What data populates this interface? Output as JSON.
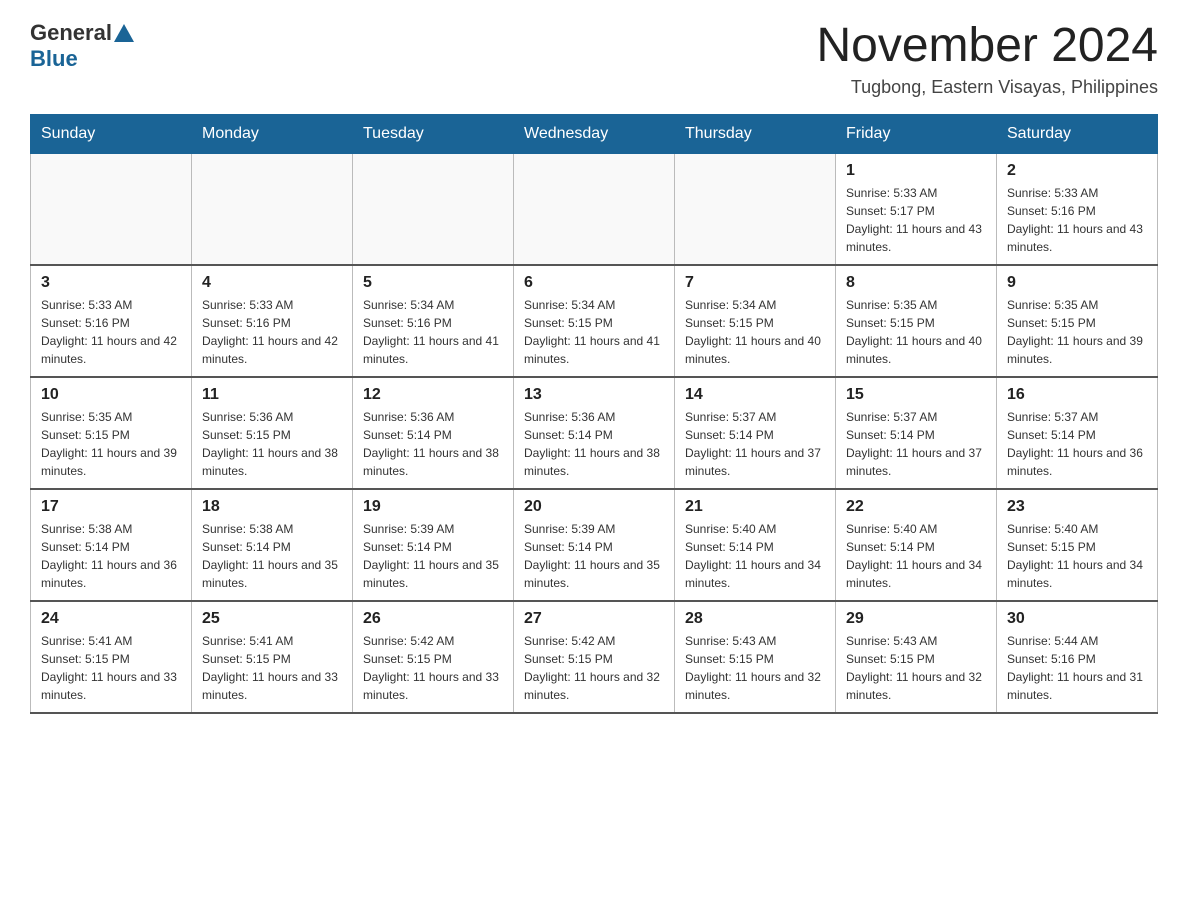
{
  "header": {
    "logo": {
      "general": "General",
      "blue": "Blue"
    },
    "title": "November 2024",
    "subtitle": "Tugbong, Eastern Visayas, Philippines"
  },
  "calendar": {
    "days_of_week": [
      "Sunday",
      "Monday",
      "Tuesday",
      "Wednesday",
      "Thursday",
      "Friday",
      "Saturday"
    ],
    "weeks": [
      [
        {
          "day": "",
          "info": ""
        },
        {
          "day": "",
          "info": ""
        },
        {
          "day": "",
          "info": ""
        },
        {
          "day": "",
          "info": ""
        },
        {
          "day": "",
          "info": ""
        },
        {
          "day": "1",
          "info": "Sunrise: 5:33 AM\nSunset: 5:17 PM\nDaylight: 11 hours and 43 minutes."
        },
        {
          "day": "2",
          "info": "Sunrise: 5:33 AM\nSunset: 5:16 PM\nDaylight: 11 hours and 43 minutes."
        }
      ],
      [
        {
          "day": "3",
          "info": "Sunrise: 5:33 AM\nSunset: 5:16 PM\nDaylight: 11 hours and 42 minutes."
        },
        {
          "day": "4",
          "info": "Sunrise: 5:33 AM\nSunset: 5:16 PM\nDaylight: 11 hours and 42 minutes."
        },
        {
          "day": "5",
          "info": "Sunrise: 5:34 AM\nSunset: 5:16 PM\nDaylight: 11 hours and 41 minutes."
        },
        {
          "day": "6",
          "info": "Sunrise: 5:34 AM\nSunset: 5:15 PM\nDaylight: 11 hours and 41 minutes."
        },
        {
          "day": "7",
          "info": "Sunrise: 5:34 AM\nSunset: 5:15 PM\nDaylight: 11 hours and 40 minutes."
        },
        {
          "day": "8",
          "info": "Sunrise: 5:35 AM\nSunset: 5:15 PM\nDaylight: 11 hours and 40 minutes."
        },
        {
          "day": "9",
          "info": "Sunrise: 5:35 AM\nSunset: 5:15 PM\nDaylight: 11 hours and 39 minutes."
        }
      ],
      [
        {
          "day": "10",
          "info": "Sunrise: 5:35 AM\nSunset: 5:15 PM\nDaylight: 11 hours and 39 minutes."
        },
        {
          "day": "11",
          "info": "Sunrise: 5:36 AM\nSunset: 5:15 PM\nDaylight: 11 hours and 38 minutes."
        },
        {
          "day": "12",
          "info": "Sunrise: 5:36 AM\nSunset: 5:14 PM\nDaylight: 11 hours and 38 minutes."
        },
        {
          "day": "13",
          "info": "Sunrise: 5:36 AM\nSunset: 5:14 PM\nDaylight: 11 hours and 38 minutes."
        },
        {
          "day": "14",
          "info": "Sunrise: 5:37 AM\nSunset: 5:14 PM\nDaylight: 11 hours and 37 minutes."
        },
        {
          "day": "15",
          "info": "Sunrise: 5:37 AM\nSunset: 5:14 PM\nDaylight: 11 hours and 37 minutes."
        },
        {
          "day": "16",
          "info": "Sunrise: 5:37 AM\nSunset: 5:14 PM\nDaylight: 11 hours and 36 minutes."
        }
      ],
      [
        {
          "day": "17",
          "info": "Sunrise: 5:38 AM\nSunset: 5:14 PM\nDaylight: 11 hours and 36 minutes."
        },
        {
          "day": "18",
          "info": "Sunrise: 5:38 AM\nSunset: 5:14 PM\nDaylight: 11 hours and 35 minutes."
        },
        {
          "day": "19",
          "info": "Sunrise: 5:39 AM\nSunset: 5:14 PM\nDaylight: 11 hours and 35 minutes."
        },
        {
          "day": "20",
          "info": "Sunrise: 5:39 AM\nSunset: 5:14 PM\nDaylight: 11 hours and 35 minutes."
        },
        {
          "day": "21",
          "info": "Sunrise: 5:40 AM\nSunset: 5:14 PM\nDaylight: 11 hours and 34 minutes."
        },
        {
          "day": "22",
          "info": "Sunrise: 5:40 AM\nSunset: 5:14 PM\nDaylight: 11 hours and 34 minutes."
        },
        {
          "day": "23",
          "info": "Sunrise: 5:40 AM\nSunset: 5:15 PM\nDaylight: 11 hours and 34 minutes."
        }
      ],
      [
        {
          "day": "24",
          "info": "Sunrise: 5:41 AM\nSunset: 5:15 PM\nDaylight: 11 hours and 33 minutes."
        },
        {
          "day": "25",
          "info": "Sunrise: 5:41 AM\nSunset: 5:15 PM\nDaylight: 11 hours and 33 minutes."
        },
        {
          "day": "26",
          "info": "Sunrise: 5:42 AM\nSunset: 5:15 PM\nDaylight: 11 hours and 33 minutes."
        },
        {
          "day": "27",
          "info": "Sunrise: 5:42 AM\nSunset: 5:15 PM\nDaylight: 11 hours and 32 minutes."
        },
        {
          "day": "28",
          "info": "Sunrise: 5:43 AM\nSunset: 5:15 PM\nDaylight: 11 hours and 32 minutes."
        },
        {
          "day": "29",
          "info": "Sunrise: 5:43 AM\nSunset: 5:15 PM\nDaylight: 11 hours and 32 minutes."
        },
        {
          "day": "30",
          "info": "Sunrise: 5:44 AM\nSunset: 5:16 PM\nDaylight: 11 hours and 31 minutes."
        }
      ]
    ]
  }
}
